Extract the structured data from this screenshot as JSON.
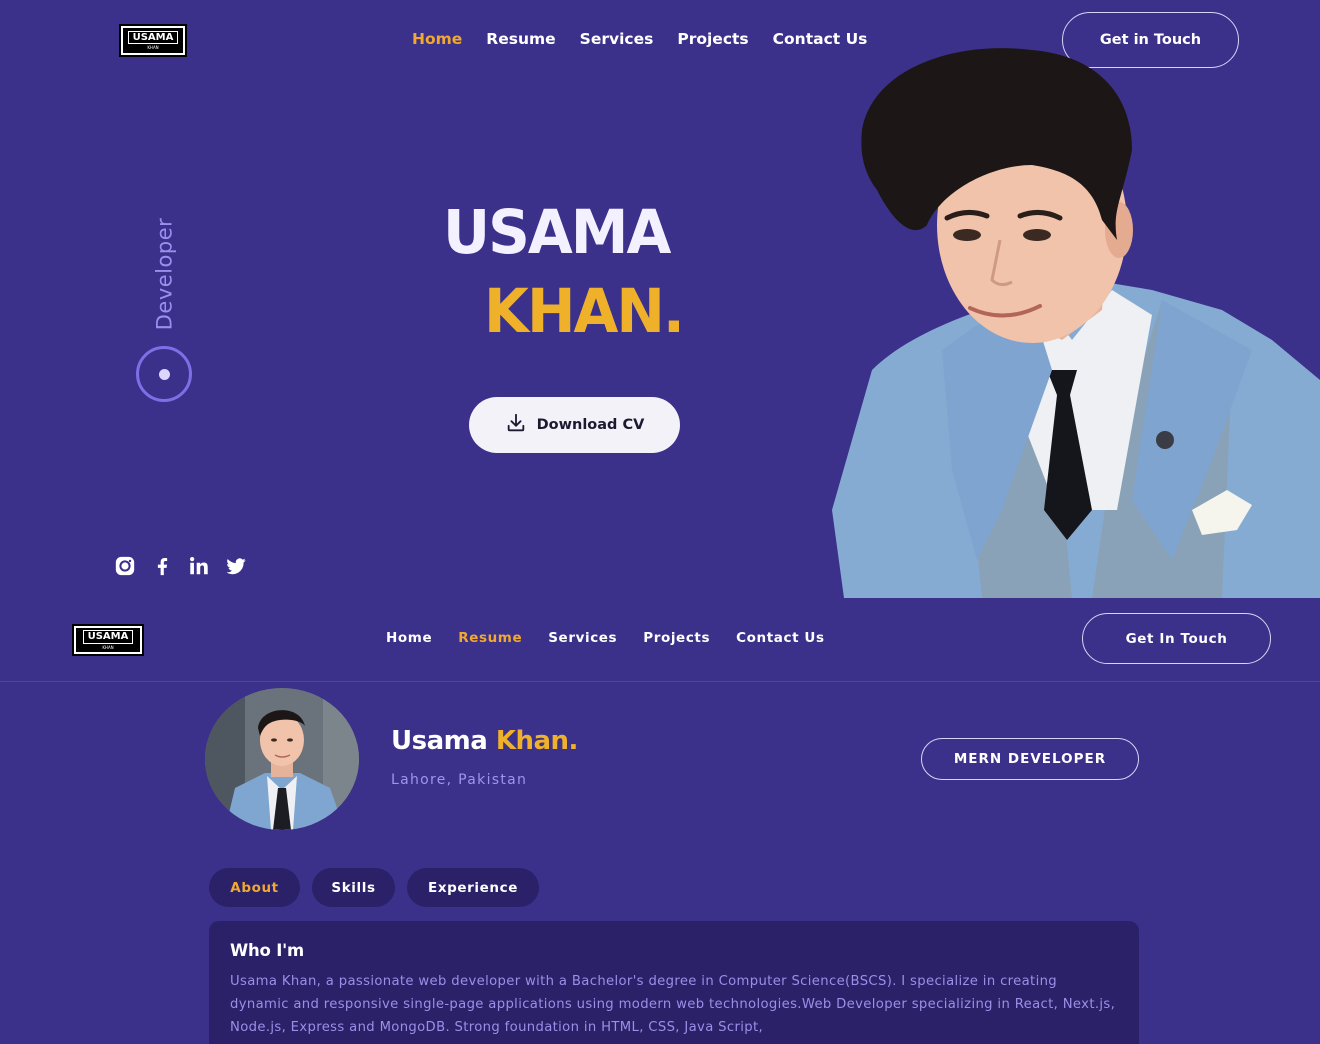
{
  "logo": {
    "text": "USAMA",
    "sub": "KHAN"
  },
  "nav": {
    "items": [
      "Home",
      "Resume",
      "Services",
      "Projects",
      "Contact Us"
    ],
    "cta": "Get in Touch"
  },
  "hero": {
    "vertical_role": "Developer",
    "first_name": "USAMA",
    "last_name": "KHAN.",
    "download_label": "Download CV",
    "socials": [
      "instagram-icon",
      "facebook-icon",
      "linkedin-icon",
      "twitter-icon"
    ]
  },
  "sticky_nav": {
    "items": [
      "Home",
      "Resume",
      "Services",
      "Projects",
      "Contact Us"
    ],
    "active": "Resume",
    "cta": "Get In Touch"
  },
  "resume": {
    "name_first": "Usama",
    "name_last": "Khan.",
    "location": "Lahore, Pakistan",
    "role_badge": "MERN DEVELOPER",
    "tabs": [
      "About",
      "Skills",
      "Experience"
    ],
    "active_tab": "About",
    "about": {
      "title": "Who I'm",
      "text": "Usama Khan, a passionate web developer with a Bachelor's degree in Computer Science(BSCS). I specialize in creating dynamic and responsive single-page applications using modern web technologies.Web Developer specializing in React, Next.js, Node.js, Express and MongoDB. Strong foundation in HTML, CSS, Java Script,"
    }
  },
  "colors": {
    "background": "#3b318a",
    "accent": "#f0b12a",
    "card": "#2a2168",
    "muted_text": "#9a8fe8"
  }
}
